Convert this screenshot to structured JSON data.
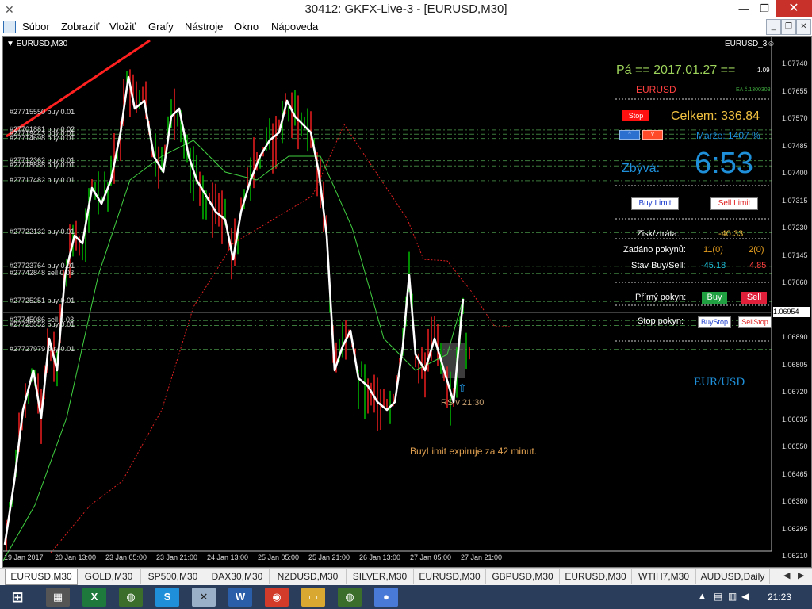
{
  "window": {
    "title": "30412: GKFX-Live-3 - [EURUSD,M30]",
    "minimize": "—",
    "restore": "❐",
    "close": "✕"
  },
  "menu": [
    "Súbor",
    "Zobraziť",
    "Vložiť",
    "Grafy",
    "Nástroje",
    "Okno",
    "Nápoveda"
  ],
  "chart": {
    "symbol_label": "▼ EURUSD,M30",
    "ea_label": "EURUSD_3☺",
    "price_axis": [
      "1.07740",
      "1.07655",
      "1.07570",
      "1.07485",
      "1.07400",
      "1.07315",
      "1.07230",
      "1.07145",
      "1.07060",
      "1.06975",
      "1.06890",
      "1.06805",
      "1.06720",
      "1.06635",
      "1.06550",
      "1.06465",
      "1.06380",
      "1.06295",
      "1.06210"
    ],
    "current_price": "1.06954",
    "time_axis": [
      "19 Jan 2017",
      "20 Jan 13:00",
      "23 Jan 05:00",
      "23 Jan 21:00",
      "24 Jan 13:00",
      "25 Jan 05:00",
      "25 Jan 21:00",
      "26 Jan 13:00",
      "27 Jan 05:00",
      "27 Jan 21:00"
    ],
    "orders": [
      {
        "label": "#27715550 buy 0.01",
        "y": 0.1429
      },
      {
        "label": "#27701881 buy 0.02",
        "y": 0.175
      },
      {
        "label": "#27719443 buy 0.01",
        "y": 0.183
      },
      {
        "label": "#27714698 buy 0.01",
        "y": 0.191
      },
      {
        "label": "#27712362 buy 0.01",
        "y": 0.2329
      },
      {
        "label": "#27718888 buy 0.01",
        "y": 0.2429
      },
      {
        "label": "#27717482 buy 0.01",
        "y": 0.2707
      },
      {
        "label": "#27722132 buy 0.01",
        "y": 0.3688
      },
      {
        "label": "#27723764 buy 0.01",
        "y": 0.4322
      },
      {
        "label": "#27742848 sell 0.03",
        "y": 0.4457
      },
      {
        "label": "#27725251 buy 0.01",
        "y": 0.4988
      },
      {
        "label": "#27745086 sell 0.03",
        "y": 0.5348
      },
      {
        "label": "#27725552 buy 0.01",
        "y": 0.5441
      },
      {
        "label": "#27727979 buy 0.01",
        "y": 0.5892
      }
    ],
    "rs_label": "RS v 21:30",
    "buylimit_msg": "BuyLimit expiruje za 42 minut.",
    "pair_label": "EUR/USD"
  },
  "panel": {
    "date_line": "Pá  ==  2017.01.27  ==",
    "version": "1.09",
    "symbol": "EURUSD",
    "ea_code": "EA č.1300303",
    "stop_button": "Stop",
    "celkem": "Celkem: 336.84",
    "marze": "Marže:  1407 %",
    "zbyva_label": "Zbývá:",
    "zbyva_time": "6:53",
    "buy_limit_button": "Buy Limit",
    "sell_limit_button": "Sell Limit",
    "zisk_label": "Zisk/ztráta:",
    "zisk_value": "-40.33",
    "zadano_label": "Zadáno pokynů:",
    "zadano_buy": "11(0)",
    "zadano_sell": "2(0)",
    "stav_label": "Stav Buy/Sell:",
    "stav_buy": "-45.18",
    "stav_sell": "4.85",
    "primy_label": "Přímý pokyn:",
    "buy_button": "Buy",
    "sell_button": "Sell",
    "stop_pokyn_label": "Stop pokyn:",
    "buystop_button": "BuyStop",
    "sellstop_button": "SellStop"
  },
  "tabs": [
    "EURUSD,M30",
    "GOLD,M30",
    "SP500,M30",
    "DAX30,M30",
    "NZDUSD,M30",
    "SILVER,M30",
    "EURUSD,M30",
    "GBPUSD,M30",
    "EURUSD,M30",
    "WTIH7,M30",
    "AUDUSD,Daily"
  ],
  "taskbar": {
    "time": "21:23"
  },
  "colors": {
    "chart_bg": "#000000",
    "bull": "#00c800",
    "bear": "#ff2020",
    "main_line": "#ffffff",
    "level_line": "#3c7a3c",
    "accent_blue": "#1e8fd8"
  }
}
